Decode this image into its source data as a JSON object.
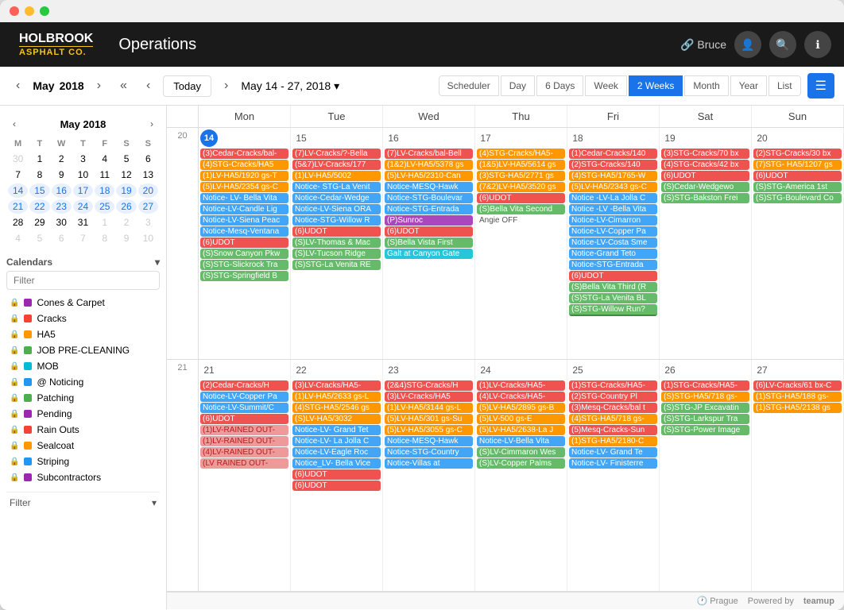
{
  "window": {
    "title": "Operations - Holbrook Asphalt Co."
  },
  "header": {
    "logo_line1": "HOLBROOK",
    "logo_line2": "ASPHALT CO.",
    "title": "Operations",
    "user": "Bruce"
  },
  "toolbar": {
    "prev_month": "‹",
    "next_month": "›",
    "mini_nav_left": "«",
    "mini_nav_prev": "‹",
    "today": "Today",
    "mini_nav_next": "›",
    "date_range": "May 14 - 27, 2018",
    "dropdown_icon": "▾",
    "views": [
      "Scheduler",
      "Day",
      "6 Days",
      "Week",
      "2 Weeks",
      "Month",
      "Year",
      "List"
    ],
    "active_view": "2 Weeks"
  },
  "mini_calendar": {
    "month_year": "May 2018",
    "days_header": [
      "M",
      "T",
      "W",
      "T",
      "F",
      "S",
      "S"
    ],
    "weeks": [
      [
        30,
        1,
        2,
        3,
        4,
        5,
        6
      ],
      [
        7,
        8,
        9,
        10,
        11,
        12,
        13
      ],
      [
        14,
        15,
        16,
        17,
        18,
        19,
        20
      ],
      [
        21,
        22,
        23,
        24,
        25,
        26,
        27
      ],
      [
        28,
        29,
        30,
        31,
        1,
        2,
        3
      ],
      [
        4,
        5,
        6,
        7,
        8,
        9,
        10
      ]
    ]
  },
  "sidebar": {
    "calendars_label": "Calendars",
    "filter_placeholder": "Filter",
    "items": [
      {
        "id": "cones",
        "label": "Cones & Carpet",
        "color": "#9c27b0"
      },
      {
        "id": "cracks",
        "label": "Cracks",
        "color": "#f44336"
      },
      {
        "id": "ha5",
        "label": "HA5",
        "color": "#ff9800"
      },
      {
        "id": "job-pre",
        "label": "JOB PRE-CLEANING",
        "color": "#4caf50"
      },
      {
        "id": "mob",
        "label": "MOB",
        "color": "#00bcd4"
      },
      {
        "id": "noticing",
        "label": "Noticing",
        "color": "#2196f3"
      },
      {
        "id": "patching",
        "label": "Patching",
        "color": "#4caf50"
      },
      {
        "id": "pending",
        "label": "Pending",
        "color": "#9c27b0"
      },
      {
        "id": "rain-outs",
        "label": "Rain Outs",
        "color": "#f44336"
      },
      {
        "id": "sealcoat",
        "label": "Sealcoat",
        "color": "#ff9800"
      },
      {
        "id": "striping",
        "label": "Striping",
        "color": "#2196f3"
      },
      {
        "id": "subcontractors",
        "label": "Subcontractors",
        "color": "#9c27b0"
      }
    ],
    "filter_label": "Filter"
  },
  "calendar": {
    "week_nums": [
      "20",
      "21"
    ],
    "day_headers": [
      "Mon",
      "Tue",
      "Wed",
      "Thu",
      "Fri",
      "Sat",
      "Sun"
    ],
    "week1": {
      "dates": [
        "May 14, 2018",
        "15",
        "16",
        "17",
        "18",
        "19",
        "20"
      ],
      "date_nums": [
        14,
        15,
        16,
        17,
        18,
        19,
        20
      ],
      "events": {
        "mon": [
          {
            "text": "(3)Cedar-Cracks/bal-",
            "color": "#ef5350"
          },
          {
            "text": "(4)STG-Cracks/HA5",
            "color": "#ff9800"
          },
          {
            "text": "(1)LV-HA5/1920 gs-T",
            "color": "#ff9800"
          },
          {
            "text": "(5)LV-HA5/2354 gs-C",
            "color": "#ff9800"
          },
          {
            "text": "Notice- LV- Bella Vita",
            "color": "#42a5f5"
          },
          {
            "text": "Notice-LV-Candle Lig",
            "color": "#42a5f5"
          },
          {
            "text": "Notice-LV-Siena Peac",
            "color": "#42a5f5"
          },
          {
            "text": "Notice-Mesq-Ventana-",
            "color": "#42a5f5"
          },
          {
            "text": "(6)UDOT",
            "color": "#ef5350"
          },
          {
            "text": "(S)Snow Canyon Pkw",
            "color": "#66bb6a"
          },
          {
            "text": "(S)STG-Slickrock Tra",
            "color": "#66bb6a"
          },
          {
            "text": "(S)STG-Springfield B",
            "color": "#66bb6a"
          }
        ],
        "tue": [
          {
            "text": "(7)LV-Cracks/?-Bella",
            "color": "#ef5350"
          },
          {
            "text": "(5&7)LV-Cracks/177",
            "color": "#ef5350"
          },
          {
            "text": "(1)LV-HA5/5002",
            "color": "#ff9800"
          },
          {
            "text": "Notice- STG-La Venit",
            "color": "#42a5f5"
          },
          {
            "text": "Notice-Cedar-Wedge",
            "color": "#42a5f5"
          },
          {
            "text": "Notice-LV-Siena ORA",
            "color": "#42a5f5"
          },
          {
            "text": "Notice-STG-Willow R",
            "color": "#42a5f5"
          },
          {
            "text": "(6)UDOT",
            "color": "#ef5350"
          },
          {
            "text": "(S)LV-Thomas & Mac",
            "color": "#66bb6a"
          },
          {
            "text": "(S)LV-Tucson Ridge",
            "color": "#66bb6a"
          },
          {
            "text": "(S)STG-La Venita RE",
            "color": "#66bb6a"
          }
        ],
        "wed": [
          {
            "text": "(7)LV-Cracks/bal-Bell",
            "color": "#ef5350"
          },
          {
            "text": "(1&2)LV-HA5/5378 gs",
            "color": "#ff9800"
          },
          {
            "text": "(5)LV-HA5/2310-Can",
            "color": "#ff9800"
          },
          {
            "text": "Notice-MESQ-Hawk",
            "color": "#42a5f5"
          },
          {
            "text": "Notice-STG-Boulevar",
            "color": "#42a5f5"
          },
          {
            "text": "Notice-STG-Entrada",
            "color": "#42a5f5"
          },
          {
            "text": "(P)Sunroc",
            "color": "#ab47bc"
          },
          {
            "text": "(6)UDOT",
            "color": "#ef5350"
          },
          {
            "text": "(S)Bella Vista First (Y",
            "color": "#66bb6a"
          },
          {
            "text": "Galt at Canyon Gate",
            "color": "#26c6da"
          }
        ],
        "thu": [
          {
            "text": "(4)STG-Cracks/HA5-",
            "color": "#ff9800"
          },
          {
            "text": "(1&5)LV-HA5/5614 gs",
            "color": "#ff9800"
          },
          {
            "text": "(3)STG-HA5/2771 gs",
            "color": "#ff9800"
          },
          {
            "text": "(7&2)LV-HA5/3520 gs",
            "color": "#ff9800"
          },
          {
            "text": "(6)UDOT",
            "color": "#ef5350"
          },
          {
            "text": "(S)Bella Vita Second",
            "color": "#66bb6a"
          }
        ],
        "fri": [
          {
            "text": "(1)Cedar-Cracks/140",
            "color": "#ef5350"
          },
          {
            "text": "(2)STG-Cracks/140",
            "color": "#ef5350"
          },
          {
            "text": "(4)STG-HA5/1765-W",
            "color": "#ff9800"
          },
          {
            "text": "(5)LV-HA5/2343 gs-C",
            "color": "#ff9800"
          },
          {
            "text": "Notice -LV-La Jolla C",
            "color": "#42a5f5"
          },
          {
            "text": "Notice -LV -Bella Vita",
            "color": "#42a5f5"
          },
          {
            "text": "Notice-LV-Cimarron",
            "color": "#42a5f5"
          },
          {
            "text": "Notice-LV-Copper Pa",
            "color": "#42a5f5"
          },
          {
            "text": "Notice-LV-Costa Sme",
            "color": "#42a5f5"
          },
          {
            "text": "Notice-Grand Teto",
            "color": "#42a5f5"
          },
          {
            "text": "Notice-STG-Entrada",
            "color": "#42a5f5"
          },
          {
            "text": "(6)UDOT",
            "color": "#ef5350"
          },
          {
            "text": "(S)Bella Vita Third (R",
            "color": "#66bb6a"
          },
          {
            "text": "(S)STG-La Venita BL",
            "color": "#66bb6a"
          },
          {
            "text": "(S)STG-Willow Run?",
            "color": "#66bb6a"
          }
        ],
        "sat": [
          {
            "text": "(3)STG-Cracks/70 bx",
            "color": "#ef5350"
          },
          {
            "text": "(4)STG-Cracks/42 bx",
            "color": "#ef5350"
          },
          {
            "text": "(6)UDOT",
            "color": "#ef5350"
          },
          {
            "text": "(S)Cedar-Wedgewo",
            "color": "#66bb6a"
          },
          {
            "text": "(S)STG-Bakston Frei",
            "color": "#66bb6a"
          }
        ],
        "sun": [
          {
            "text": "(2)STG-Cracks/30 bx",
            "color": "#ef5350"
          },
          {
            "text": "(7)STG- HA5/1207 gs",
            "color": "#ff9800"
          },
          {
            "text": "(6)UDOT",
            "color": "#ef5350"
          },
          {
            "text": "(S)STG-America 1st",
            "color": "#66bb6a"
          },
          {
            "text": "(S)STG-Boulevard Co",
            "color": "#66bb6a"
          }
        ]
      }
    },
    "week2": {
      "dates": [
        "21",
        "22",
        "23",
        "24",
        "25",
        "26",
        "27"
      ],
      "date_nums": [
        21,
        22,
        23,
        24,
        25,
        26,
        27
      ],
      "events": {
        "mon": [
          {
            "text": "(2)Cedar-Cracks/H",
            "color": "#ef5350"
          },
          {
            "text": "Notice-LV-Copper Pa",
            "color": "#42a5f5"
          },
          {
            "text": "Notice-LV-Summit/C",
            "color": "#42a5f5"
          },
          {
            "text": "(6)UDOT",
            "color": "#ef5350"
          },
          {
            "text": "(1)LV-RAINED OUT-",
            "color": "#ef9a9a"
          },
          {
            "text": "(1)LV-RAINED OUT-",
            "color": "#ef9a9a"
          },
          {
            "text": "(4)LV-RAINED OUT-",
            "color": "#ef9a9a"
          },
          {
            "text": "(LV RAINED OUT-",
            "color": "#ef9a9a"
          }
        ],
        "tue": [
          {
            "text": "(3)LV-Cracks/HA5-",
            "color": "#ef5350"
          },
          {
            "text": "(1)LV-HA5/2633 gs-L",
            "color": "#ff9800"
          },
          {
            "text": "(4)STG-HA5/2546 gs",
            "color": "#ff9800"
          },
          {
            "text": "(S)LV-HA5/3032",
            "color": "#ff9800"
          },
          {
            "text": "Notice-LV- Grand Tet",
            "color": "#42a5f5"
          },
          {
            "text": "Notice-LV- La Jolla C",
            "color": "#42a5f5"
          },
          {
            "text": "Notice-LV-Eagle Roc",
            "color": "#42a5f5"
          },
          {
            "text": "Notice_LV- Bella Vice",
            "color": "#42a5f5"
          },
          {
            "text": "(6)UDOT",
            "color": "#ef5350"
          },
          {
            "text": "(6)UDOT",
            "color": "#ef5350"
          }
        ],
        "wed": [
          {
            "text": "(2&4)STG-Cracks/H",
            "color": "#ef5350"
          },
          {
            "text": "(3)LV-Cracks/HA5",
            "color": "#ef5350"
          },
          {
            "text": "(1)LV-HA5/3144 gs-L",
            "color": "#ff9800"
          },
          {
            "text": "(5)LV-HA5/301 gs-Su",
            "color": "#ff9800"
          },
          {
            "text": "(5)LV-HA5/3055 gs-C",
            "color": "#ff9800"
          },
          {
            "text": "Notice-MESQ-Hawk",
            "color": "#42a5f5"
          },
          {
            "text": "Notice-STG-Country",
            "color": "#42a5f5"
          },
          {
            "text": "Notice-Villas at",
            "color": "#42a5f5"
          }
        ],
        "thu": [
          {
            "text": "(1)LV-Cracks/HA5-",
            "color": "#ef5350"
          },
          {
            "text": "(4)LV-Cracks/HA5-",
            "color": "#ef5350"
          },
          {
            "text": "(5)LV-HA5/2895 gs-B",
            "color": "#ff9800"
          },
          {
            "text": "(5)LV-500 gs-E",
            "color": "#ff9800"
          },
          {
            "text": "(5)LV-HA5/2638-La J",
            "color": "#ff9800"
          },
          {
            "text": "Notice-LV-Bella Vita",
            "color": "#42a5f5"
          },
          {
            "text": "(S)LV-Cimmaron Wes",
            "color": "#66bb6a"
          },
          {
            "text": "(S)LV-Copper Palms",
            "color": "#66bb6a"
          }
        ],
        "fri": [
          {
            "text": "(1)STG-Cracks/HA5-",
            "color": "#ef5350"
          },
          {
            "text": "(2)STG-Country Pl",
            "color": "#ef5350"
          },
          {
            "text": "(3)Mesq-Cracks/bal t",
            "color": "#ef5350"
          },
          {
            "text": "(4)STG-HA5/718 gs-",
            "color": "#ff9800"
          },
          {
            "text": "(5)Mesq-Cracks-Sun",
            "color": "#ef5350"
          },
          {
            "text": "(1)STG-HA5/2180-C",
            "color": "#ff9800"
          },
          {
            "text": "Notice-LV- Grand Te",
            "color": "#42a5f5"
          },
          {
            "text": "Notice-LV- Finisterre",
            "color": "#42a5f5"
          }
        ],
        "sat": [
          {
            "text": "(1)STG-Cracks/HA5-",
            "color": "#ef5350"
          },
          {
            "text": "(S)STG-HA5/718 gs-",
            "color": "#ff9800"
          },
          {
            "text": "(S)STG-JP Excavatin",
            "color": "#66bb6a"
          },
          {
            "text": "(S)STG-Larkspur Tra",
            "color": "#66bb6a"
          },
          {
            "text": "(S)STG-Power Image",
            "color": "#66bb6a"
          }
        ],
        "sun": [
          {
            "text": "(6)LV-Cracks/61 bx-C",
            "color": "#ef5350"
          },
          {
            "text": "(1)STG-HA5/188 gs-",
            "color": "#ff9800"
          },
          {
            "text": "(1)STG-HA5/2138 gs",
            "color": "#ff9800"
          }
        ]
      }
    }
  },
  "footer": {
    "timezone": "Prague",
    "powered_by": "Powered by",
    "provider": "teamup"
  }
}
